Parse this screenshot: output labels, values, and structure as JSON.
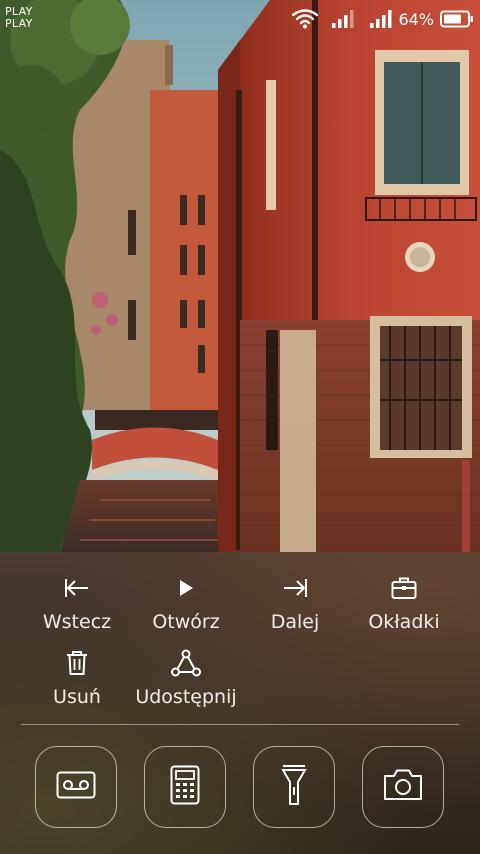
{
  "status_bar": {
    "notifications": [
      "PLAY",
      "PLAY"
    ],
    "battery_percent": "64%",
    "icons": [
      "wifi-icon",
      "signal-icon",
      "signal-icon",
      "battery-icon"
    ]
  },
  "wallpaper": {
    "description_icon": "wallpaper-image"
  },
  "actions": [
    {
      "id": "back",
      "label": "Wstecz",
      "icon": "previous-icon"
    },
    {
      "id": "open",
      "label": "Otwórz",
      "icon": "play-icon"
    },
    {
      "id": "next",
      "label": "Dalej",
      "icon": "next-icon"
    },
    {
      "id": "covers",
      "label": "Okładki",
      "icon": "briefcase-icon"
    },
    {
      "id": "delete",
      "label": "Usuń",
      "icon": "trash-icon"
    },
    {
      "id": "share",
      "label": "Udostępnij",
      "icon": "share-icon"
    }
  ],
  "shortcuts": [
    {
      "id": "recorder",
      "icon": "recorder-icon"
    },
    {
      "id": "calculator",
      "icon": "calculator-icon"
    },
    {
      "id": "flashlight",
      "icon": "flashlight-icon"
    },
    {
      "id": "camera",
      "icon": "camera-icon"
    }
  ],
  "colors": {
    "panel_bg": "#3d3128",
    "text": "#ffffff",
    "wall_red": "#b8412a"
  }
}
